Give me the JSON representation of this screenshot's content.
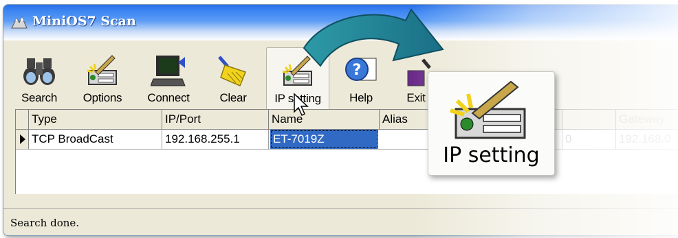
{
  "window": {
    "title": "MiniOS7 Scan"
  },
  "toolbar": {
    "search": "Search",
    "options": "Options",
    "connect": "Connect",
    "clear": "Clear",
    "ip_setting": "IP setting",
    "help": "Help",
    "exit": "Exit"
  },
  "grid": {
    "columns": [
      "Type",
      "IP/Port",
      "Name",
      "Alias",
      "",
      "Gateway"
    ],
    "rows": [
      {
        "type": "TCP BroadCast",
        "ip_port": "192.168.255.1",
        "name": "ET-7019Z",
        "alias": "",
        "col5": "0",
        "gateway": "192.168.0"
      }
    ]
  },
  "status": {
    "text": "Search done."
  },
  "zoom_callout": {
    "label": "IP setting"
  },
  "colors": {
    "title_bar": "#2a6fe8",
    "selection": "#316ac5",
    "arrow": "#1f7a8c"
  }
}
